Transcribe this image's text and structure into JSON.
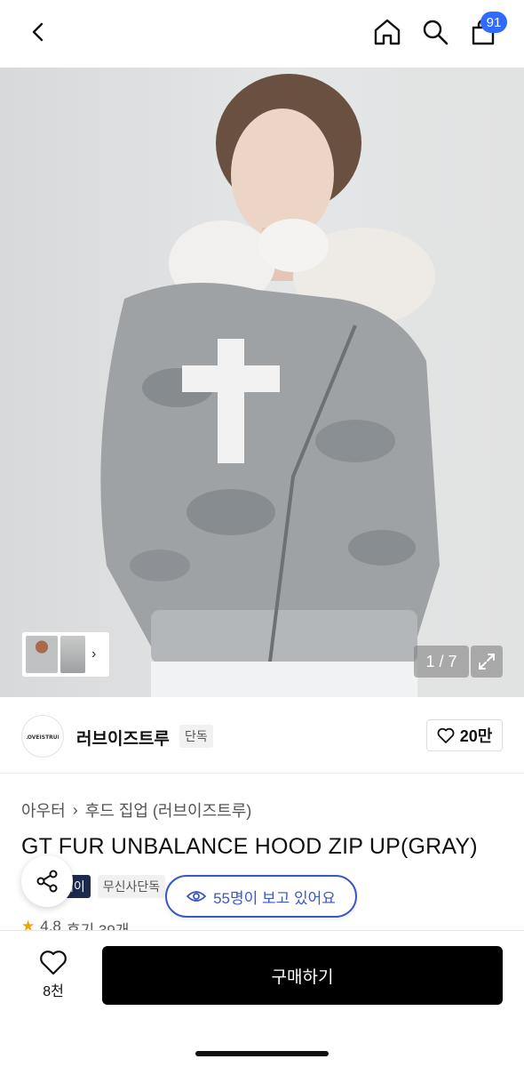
{
  "header": {
    "back_icon": "chevron-left-icon",
    "home_icon": "home-icon",
    "search_icon": "search-icon",
    "cart_icon": "shopping-bag-icon",
    "cart_count": "91"
  },
  "gallery": {
    "counter": "1 / 7",
    "expand_icon": "expand-icon"
  },
  "brand": {
    "name": "러브이즈트루",
    "tag": "단독",
    "logo_text": "LOVEISTRUE",
    "like_count": "20만"
  },
  "product": {
    "breadcrumb": [
      "아우터",
      "후드 집업 (러브이즈트루)"
    ],
    "title": "GT FUR UNBALANCE HOOD ZIP UP(GRAY)",
    "badge_dark": "데이",
    "badge_light": "무신사단독",
    "viewers": "55명이 보고 있어요",
    "rating": "4.8",
    "reviews": "후기 39개"
  },
  "bottom": {
    "wish_count": "8천",
    "buy_label": "구매하기"
  },
  "colors": {
    "accent_blue": "#3a57c7",
    "badge_blue": "#2f6bff",
    "buy_button": "#000000"
  }
}
